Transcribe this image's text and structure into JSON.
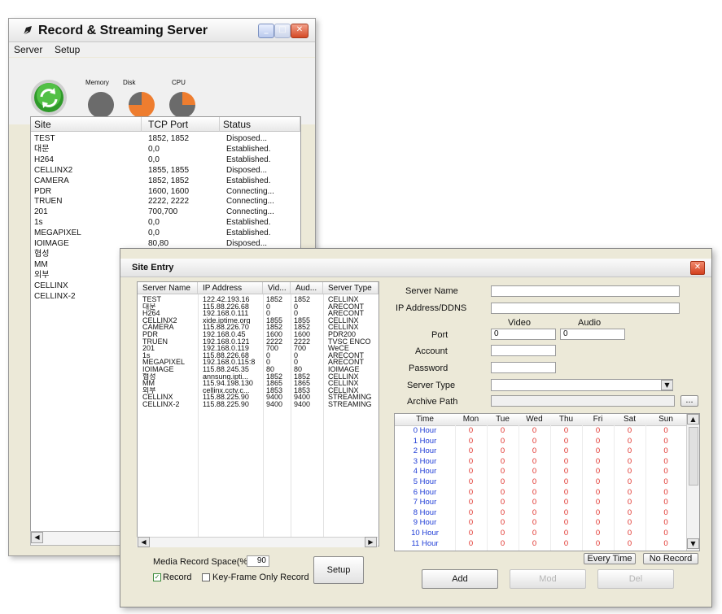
{
  "main_window": {
    "title": "Record & Streaming Server",
    "menu": [
      "Server",
      "Setup"
    ],
    "gauges": [
      {
        "label": "Memory",
        "fill_percent": 0,
        "color": "#6b6b6b"
      },
      {
        "label": "Disk",
        "fill_percent": 75,
        "color": "#ee7d2f"
      },
      {
        "label": "CPU",
        "fill_percent": 25,
        "color": "#ee7d2f"
      }
    ],
    "list_headers": [
      "Site",
      "TCP Port",
      "Status"
    ],
    "sites": [
      {
        "site": "TEST",
        "port": "1852, 1852",
        "status": "Disposed..."
      },
      {
        "site": "대문",
        "port": "0,0",
        "status": "Established."
      },
      {
        "site": "H264",
        "port": "0,0",
        "status": "Established."
      },
      {
        "site": "CELLINX2",
        "port": "1855, 1855",
        "status": "Disposed..."
      },
      {
        "site": "CAMERA",
        "port": "1852, 1852",
        "status": "Established."
      },
      {
        "site": "PDR",
        "port": "1600, 1600",
        "status": "Connecting..."
      },
      {
        "site": "TRUEN",
        "port": "2222, 2222",
        "status": "Connecting..."
      },
      {
        "site": "201",
        "port": "700,700",
        "status": "Connecting..."
      },
      {
        "site": "1s",
        "port": "0,0",
        "status": "Established."
      },
      {
        "site": "MEGAPIXEL",
        "port": "0,0",
        "status": "Established."
      },
      {
        "site": "IOIMAGE",
        "port": "80,80",
        "status": "Disposed..."
      },
      {
        "site": "협성",
        "port": "",
        "status": ""
      },
      {
        "site": "MM",
        "port": "",
        "status": ""
      },
      {
        "site": "외부",
        "port": "",
        "status": ""
      },
      {
        "site": "CELLINX",
        "port": "",
        "status": ""
      },
      {
        "site": "CELLINX-2",
        "port": "",
        "status": ""
      }
    ]
  },
  "site_entry": {
    "title": "Site Entry",
    "list_headers": [
      "Server Name",
      "IP Address",
      "Vid...",
      "Aud...",
      "Server Type"
    ],
    "servers": [
      [
        "TEST",
        "122.42.193.16",
        "1852",
        "1852",
        "CELLINX"
      ],
      [
        "대문",
        "115.88.226.68",
        "0",
        "0",
        "ARECONT"
      ],
      [
        "H264",
        "192.168.0.111",
        "0",
        "0",
        "ARECONT"
      ],
      [
        "CELLINX2",
        "xide.iptime.org",
        "1855",
        "1855",
        "CELLINX"
      ],
      [
        "CAMERA",
        "115.88.226.70",
        "1852",
        "1852",
        "CELLINX"
      ],
      [
        "PDR",
        "192.168.0.45",
        "1600",
        "1600",
        "PDR200"
      ],
      [
        "TRUEN",
        "192.168.0.121",
        "2222",
        "2222",
        "TVSC ENCO"
      ],
      [
        "201",
        "192.168.0.119",
        "700",
        "700",
        "WeCE"
      ],
      [
        "1s",
        "115.88.226.68",
        "0",
        "0",
        "ARECONT"
      ],
      [
        "MEGAPIXEL",
        "192.168.0.115:8",
        "0",
        "0",
        "ARECONT"
      ],
      [
        "IOIMAGE",
        "115.88.245.35",
        "80",
        "80",
        "IOIMAGE"
      ],
      [
        "협성",
        "annsung.ipti...",
        "1852",
        "1852",
        "CELLINX"
      ],
      [
        "MM",
        "115.94.198.130",
        "1865",
        "1865",
        "CELLINX"
      ],
      [
        "외부",
        "cellinx.cctv.c...",
        "1853",
        "1853",
        "CELLINX"
      ],
      [
        "CELLINX",
        "115.88.225.90",
        "9400",
        "9400",
        "STREAMING"
      ],
      [
        "CELLINX-2",
        "115.88.225.90",
        "9400",
        "9400",
        "STREAMING"
      ]
    ],
    "form": {
      "server_name_label": "Server Name",
      "server_name_value": "",
      "ip_label": "IP Address/DDNS",
      "ip_value": "",
      "video_label": "Video",
      "audio_label": "Audio",
      "port_label": "Port",
      "video_port": "0",
      "audio_port": "0",
      "account_label": "Account",
      "account_value": "",
      "password_label": "Password",
      "password_value": "",
      "server_type_label": "Server Type",
      "server_type_value": "",
      "archive_label": "Archive Path",
      "archive_value": "",
      "browse_label": "..."
    },
    "schedule": {
      "headers": [
        "Time",
        "Mon",
        "Tue",
        "Wed",
        "Thu",
        "Fri",
        "Sat",
        "Sun"
      ],
      "hours": [
        "0 Hour",
        "1 Hour",
        "2 Hour",
        "3 Hour",
        "4 Hour",
        "5 Hour",
        "6 Hour",
        "7 Hour",
        "8 Hour",
        "9 Hour",
        "10 Hour",
        "11 Hour"
      ],
      "cell_value": "0"
    },
    "media_space_label": "Media Record Space(%)",
    "media_space_value": "90",
    "record_label": "Record",
    "record_checked": true,
    "keyframe_label": "Key-Frame Only Record",
    "keyframe_checked": false,
    "buttons": {
      "setup": "Setup",
      "every_time": "Every Time",
      "no_record": "No Record",
      "add": "Add",
      "mod": "Mod",
      "del": "Del"
    }
  }
}
